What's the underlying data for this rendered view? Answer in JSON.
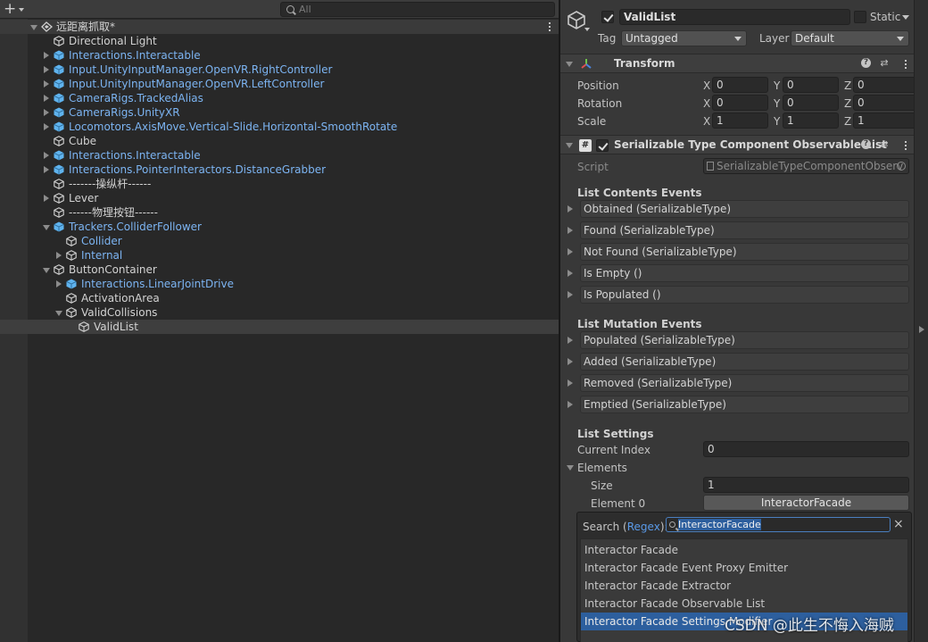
{
  "hierarchy": {
    "search_placeholder": "All",
    "items": [
      {
        "label": "远距离抓取*",
        "indent": 0,
        "expand": "down",
        "icon": "scene",
        "color": "plain",
        "scene": true
      },
      {
        "label": "Directional Light",
        "indent": 1,
        "expand": "none",
        "icon": "cube",
        "color": "plain"
      },
      {
        "label": "Interactions.Interactable",
        "indent": 1,
        "expand": "right",
        "icon": "prefab",
        "color": "blue"
      },
      {
        "label": "Input.UnityInputManager.OpenVR.RightController",
        "indent": 1,
        "expand": "right",
        "icon": "prefab",
        "color": "blue"
      },
      {
        "label": "Input.UnityInputManager.OpenVR.LeftController",
        "indent": 1,
        "expand": "right",
        "icon": "prefab",
        "color": "blue"
      },
      {
        "label": "CameraRigs.TrackedAlias",
        "indent": 1,
        "expand": "right",
        "icon": "prefab",
        "color": "blue"
      },
      {
        "label": "CameraRigs.UnityXR",
        "indent": 1,
        "expand": "right",
        "icon": "prefab",
        "color": "blue"
      },
      {
        "label": "Locomotors.AxisMove.Vertical-Slide.Horizontal-SmoothRotate",
        "indent": 1,
        "expand": "right",
        "icon": "prefab",
        "color": "blue"
      },
      {
        "label": "Cube",
        "indent": 1,
        "expand": "none",
        "icon": "cube",
        "color": "plain"
      },
      {
        "label": "Interactions.Interactable",
        "indent": 1,
        "expand": "right",
        "icon": "prefab",
        "color": "blue"
      },
      {
        "label": "Interactions.PointerInteractors.DistanceGrabber",
        "indent": 1,
        "expand": "right",
        "icon": "prefab",
        "color": "blue"
      },
      {
        "label": "-------操纵杆------",
        "indent": 1,
        "expand": "none",
        "icon": "cube",
        "color": "plain"
      },
      {
        "label": "Lever",
        "indent": 1,
        "expand": "right",
        "icon": "cube",
        "color": "plain"
      },
      {
        "label": "------物理按钮------",
        "indent": 1,
        "expand": "none",
        "icon": "cube",
        "color": "plain"
      },
      {
        "label": "Trackers.ColliderFollower",
        "indent": 1,
        "expand": "down",
        "icon": "prefab",
        "color": "blue"
      },
      {
        "label": "Collider",
        "indent": 2,
        "expand": "none",
        "icon": "cube",
        "color": "blue"
      },
      {
        "label": "Internal",
        "indent": 2,
        "expand": "right",
        "icon": "cube",
        "color": "blue"
      },
      {
        "label": "ButtonContainer",
        "indent": 1,
        "expand": "down",
        "icon": "cube",
        "color": "plain"
      },
      {
        "label": "Interactions.LinearJointDrive",
        "indent": 2,
        "expand": "right",
        "icon": "prefab",
        "color": "blue"
      },
      {
        "label": "ActivationArea",
        "indent": 2,
        "expand": "none",
        "icon": "cube",
        "color": "plain"
      },
      {
        "label": "ValidCollisions",
        "indent": 2,
        "expand": "down",
        "icon": "cube",
        "color": "plain"
      },
      {
        "label": "ValidList",
        "indent": 3,
        "expand": "none",
        "icon": "cube",
        "color": "plain",
        "selected": true
      }
    ]
  },
  "inspector": {
    "object_name": "ValidList",
    "static_label": "Static",
    "tag_label": "Tag",
    "tag_value": "Untagged",
    "layer_label": "Layer",
    "layer_value": "Default",
    "transform": {
      "title": "Transform",
      "rows": [
        {
          "label": "Position",
          "x": "0",
          "y": "0",
          "z": "0"
        },
        {
          "label": "Rotation",
          "x": "0",
          "y": "0",
          "z": "0"
        },
        {
          "label": "Scale",
          "x": "1",
          "y": "1",
          "z": "1"
        }
      ],
      "axis_x": "X",
      "axis_y": "Y",
      "axis_z": "Z"
    },
    "component": {
      "title": "Serializable Type Component Observable List",
      "script_label": "Script",
      "script_value": "SerializableTypeComponentObserv",
      "contents_header": "List Contents Events",
      "contents_events": [
        "Obtained (SerializableType)",
        "Found (SerializableType)",
        "Not Found (SerializableType)",
        "Is Empty ()",
        "Is Populated ()"
      ],
      "mutation_header": "List Mutation Events",
      "mutation_events": [
        "Populated (SerializableType)",
        "Added (SerializableType)",
        "Removed (SerializableType)",
        "Emptied (SerializableType)"
      ],
      "settings_header": "List Settings",
      "current_index_label": "Current Index",
      "current_index_value": "0",
      "elements_label": "Elements",
      "size_label": "Size",
      "size_value": "1",
      "element0_label": "Element 0",
      "element0_value": "InteractorFacade"
    }
  },
  "popup": {
    "search_prefix": "Search (",
    "regex_link": "Regex",
    "search_suffix": "):",
    "search_value": "InteractorFacade",
    "close_glyph": "×",
    "items": [
      "Interactor Facade",
      "Interactor Facade Event Proxy Emitter",
      "Interactor Facade Extractor",
      "Interactor Facade Observable List",
      "Interactor Facade Settings Modifier"
    ],
    "highlighted_index": 4
  },
  "watermark": "CSDN @此生不悔入海贼",
  "colors": {
    "accent_blue": "#7cb4f2",
    "selection": "#2d5f9e",
    "panel": "#383838",
    "hierarchy_bg": "#282828"
  }
}
